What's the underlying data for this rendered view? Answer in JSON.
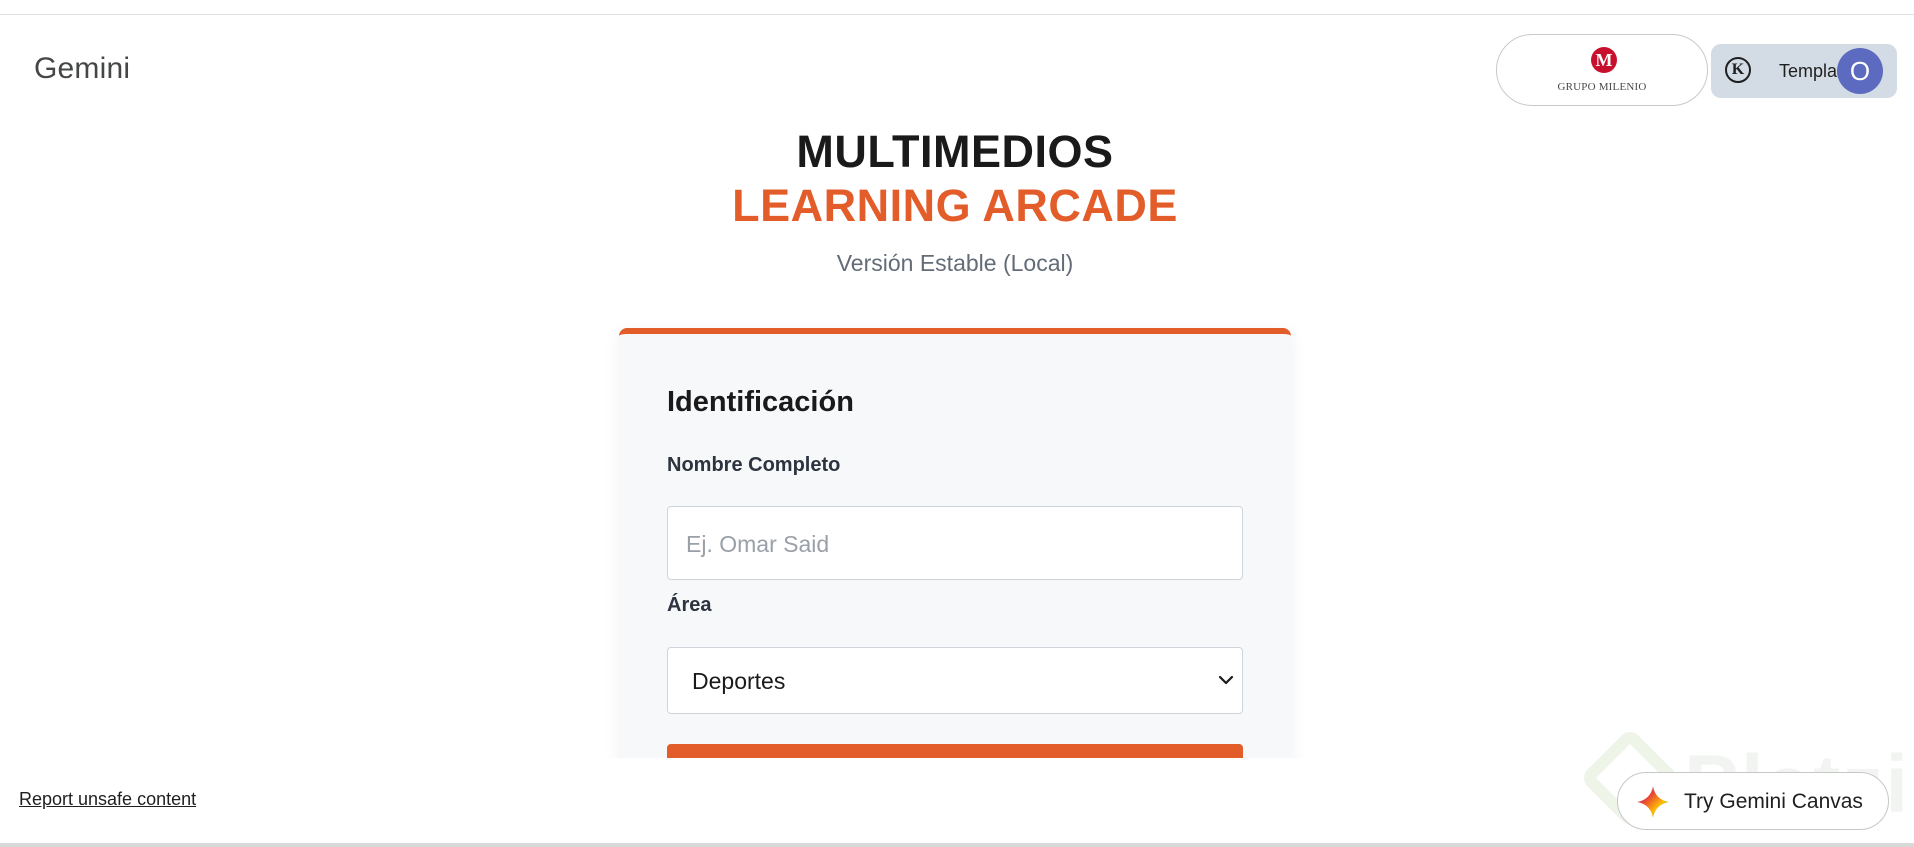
{
  "app": {
    "brand": "Gemini"
  },
  "header": {
    "partner_logo_mark": "M",
    "partner_logo_text": "GRUPO MILENIO",
    "account_chip_icon": "K",
    "account_chip_label": "Templa",
    "avatar_letter": "O"
  },
  "page": {
    "title_line1": "MULTIMEDIOS",
    "title_line2": "LEARNING ARCADE",
    "subtitle": "Versión Estable (Local)"
  },
  "form": {
    "heading": "Identificación",
    "name_label": "Nombre Completo",
    "name_placeholder": "Ej. Omar Said",
    "name_value": "",
    "area_label": "Área",
    "area_selected": "Deportes"
  },
  "footer": {
    "report_link": "Report unsafe content",
    "canvas_button": "Try Gemini Canvas",
    "watermark": "Platzi"
  },
  "colors": {
    "accent": "#e35d2a",
    "avatar": "#5c6bc0",
    "chip_bg": "#d3dbe5",
    "partner_red": "#c8102e"
  }
}
